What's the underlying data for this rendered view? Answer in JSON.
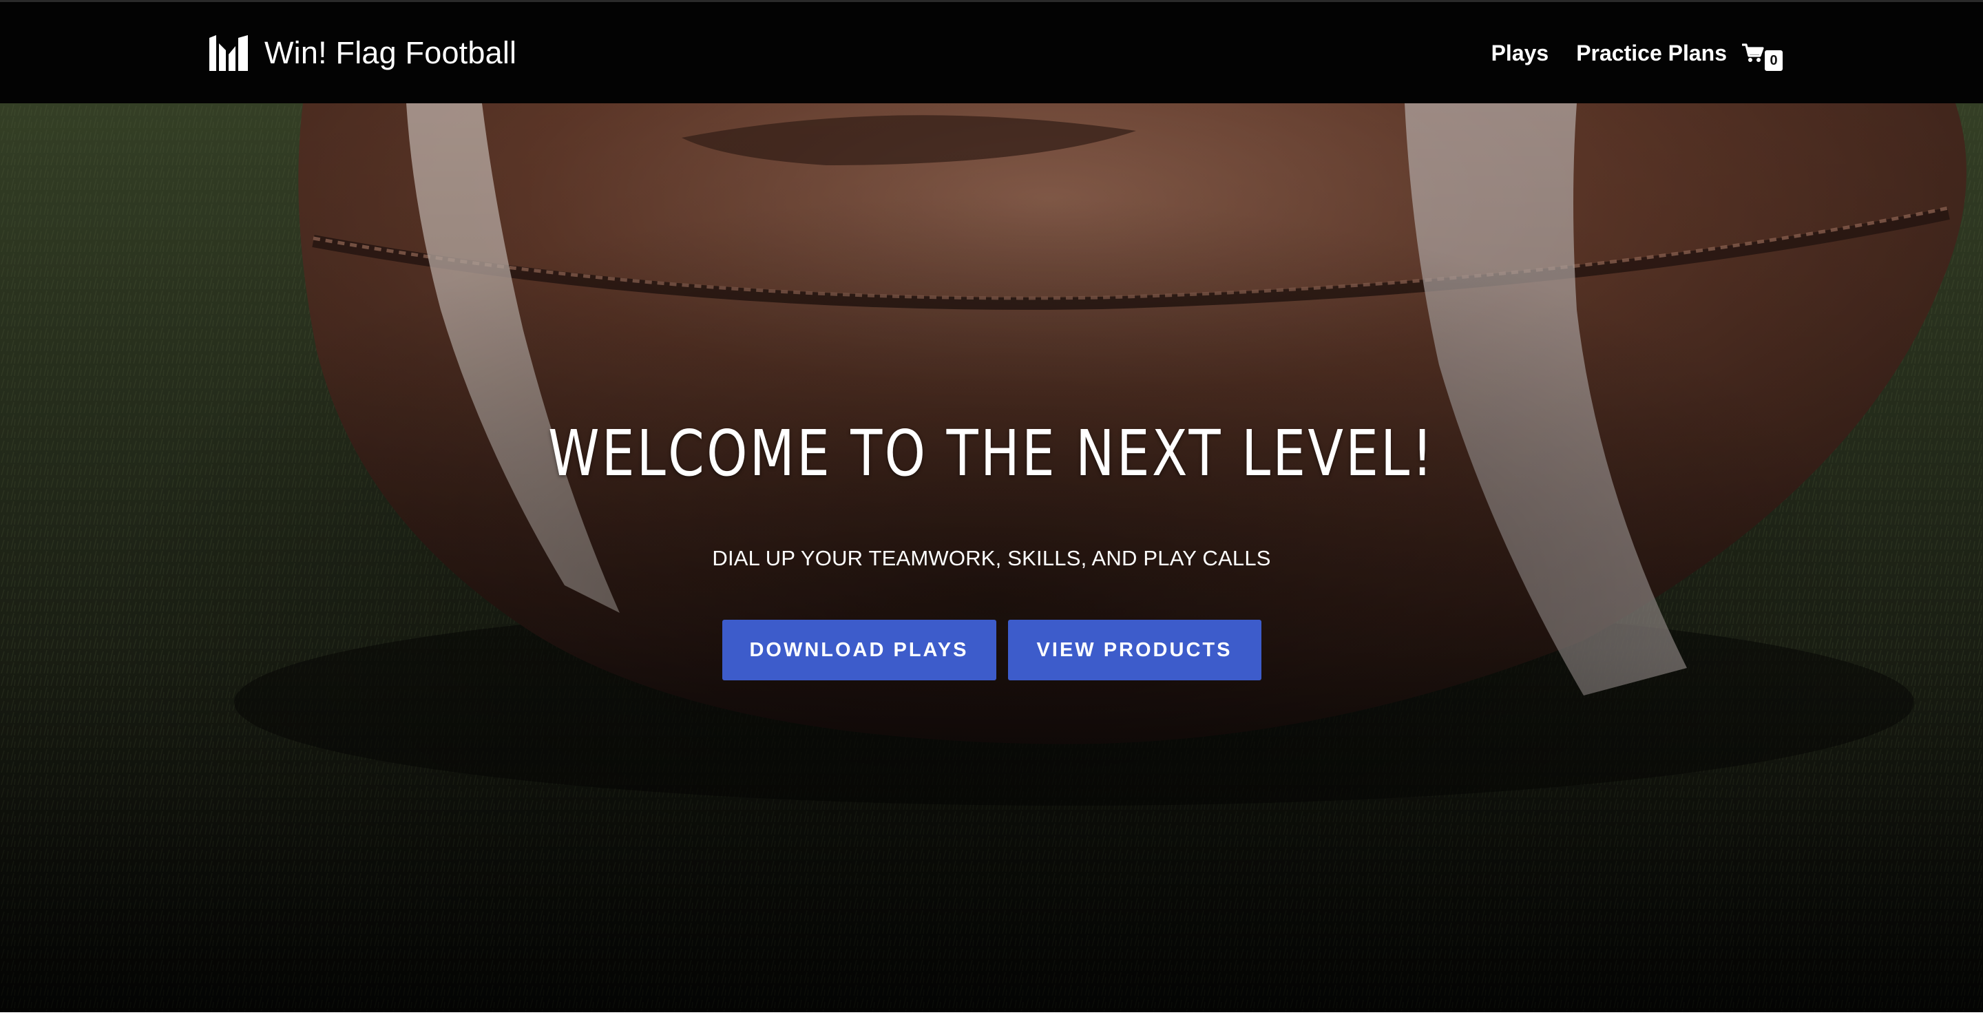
{
  "brand": {
    "name": "Win! Flag Football",
    "logo_icon": "win-logo-icon"
  },
  "nav": {
    "items": [
      {
        "label": "Plays"
      },
      {
        "label": "Practice Plans"
      }
    ],
    "cart": {
      "icon": "cart-icon",
      "count": "0"
    }
  },
  "hero": {
    "title": "WELCOME TO THE NEXT LEVEL!",
    "subtitle": "DIAL UP YOUR TEAMWORK, SKILLS, AND PLAY CALLS",
    "buttons": [
      {
        "label": "DOWNLOAD PLAYS"
      },
      {
        "label": "VIEW PRODUCTS"
      }
    ],
    "background": "football-on-turf-image"
  },
  "colors": {
    "header_bg": "#030303",
    "button_bg": "#3d5ccb",
    "text": "#ffffff"
  }
}
